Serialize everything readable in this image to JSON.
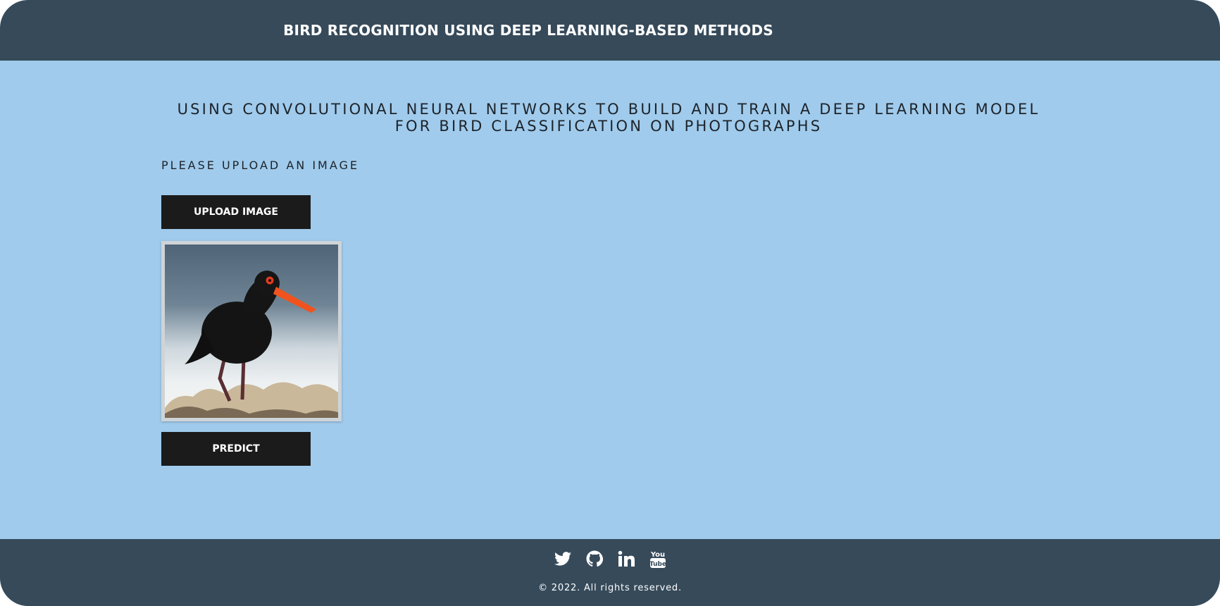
{
  "header": {
    "title": "BIRD RECOGNITION USING DEEP LEARNING-BASED METHODS"
  },
  "main": {
    "subtitle": "USING CONVOLUTIONAL NEURAL NETWORKS TO BUILD AND TRAIN A DEEP LEARNING MODEL FOR BIRD CLASSIFICATION ON PHOTOGRAPHS",
    "prompt": "PLEASE UPLOAD AN IMAGE",
    "upload_label": "UPLOAD IMAGE",
    "predict_label": "PREDICT",
    "preview_image": "bird-photo"
  },
  "footer": {
    "social_icons": [
      "twitter-icon",
      "github-icon",
      "linkedin-icon",
      "youtube-icon"
    ],
    "copyright": "© 2022. All rights reserved."
  },
  "colors": {
    "header_bg": "#364a5a",
    "page_bg": "#a0cbec",
    "button_bg": "#1b1b1c",
    "text_dark": "#1d232a"
  }
}
